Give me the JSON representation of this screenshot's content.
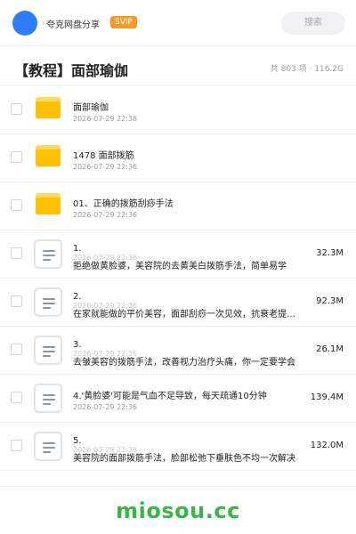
{
  "header": {
    "app_name": "夸克网盘分享",
    "badge": "SVIP",
    "search_placeholder": "搜索",
    "avatar_color": "#2f7df6",
    "badge_color": "#f39a2a"
  },
  "folder": {
    "title": "【教程】面部瑜伽",
    "summary": "共 803 项 · 116.2G"
  },
  "items": [
    {
      "type": "folder",
      "icon": "folder-icon",
      "name": "面部瑜伽",
      "date": "2026-07-29 22:36",
      "size": ""
    },
    {
      "type": "folder",
      "icon": "folder-icon",
      "name": "1478 面部拨筋",
      "date": "2026-07-29 22:36",
      "size": ""
    },
    {
      "type": "folder",
      "icon": "folder-icon",
      "name": "01、正确的拨筋刮痧手法",
      "date": "2026-07-29 22:36",
      "size": ""
    },
    {
      "type": "file",
      "icon": "document-icon",
      "name": "1.",
      "name2": "拒绝做黄脸婆，美容院的去黄美白拨筋手法，简单易学",
      "date": "2026-07-29 22:36",
      "size": "32.3M"
    },
    {
      "type": "file",
      "icon": "document-icon",
      "name": "2.",
      "name2": "在家就能做的平价美容，面部刮痧一次见效，抗衰老提拉紧致",
      "date": "2026-07-29 22:36",
      "size": "92.3M"
    },
    {
      "type": "file",
      "icon": "document-icon",
      "name": "3.",
      "name2": "去皱美容的拨筋手法，改善视力治疗头痛，你一定要学会",
      "date": "2026-07-29 22:36",
      "size": "26.1M"
    },
    {
      "type": "file",
      "icon": "document-icon",
      "name": "4.'黄脸婆'可能是气血不足导致，每天疏通10分钟",
      "date": "2026-07-29 22:36",
      "size": "139.4M"
    },
    {
      "type": "file",
      "icon": "document-icon",
      "name": "5.",
      "name2": "美容院的面部拨筋手法，脸部松弛下垂肤色不均一次解决",
      "date": "2026-07-29 22:36",
      "size": "132.0M"
    }
  ],
  "watermark": "miosou.cc",
  "watermark_color": "#39b54a"
}
